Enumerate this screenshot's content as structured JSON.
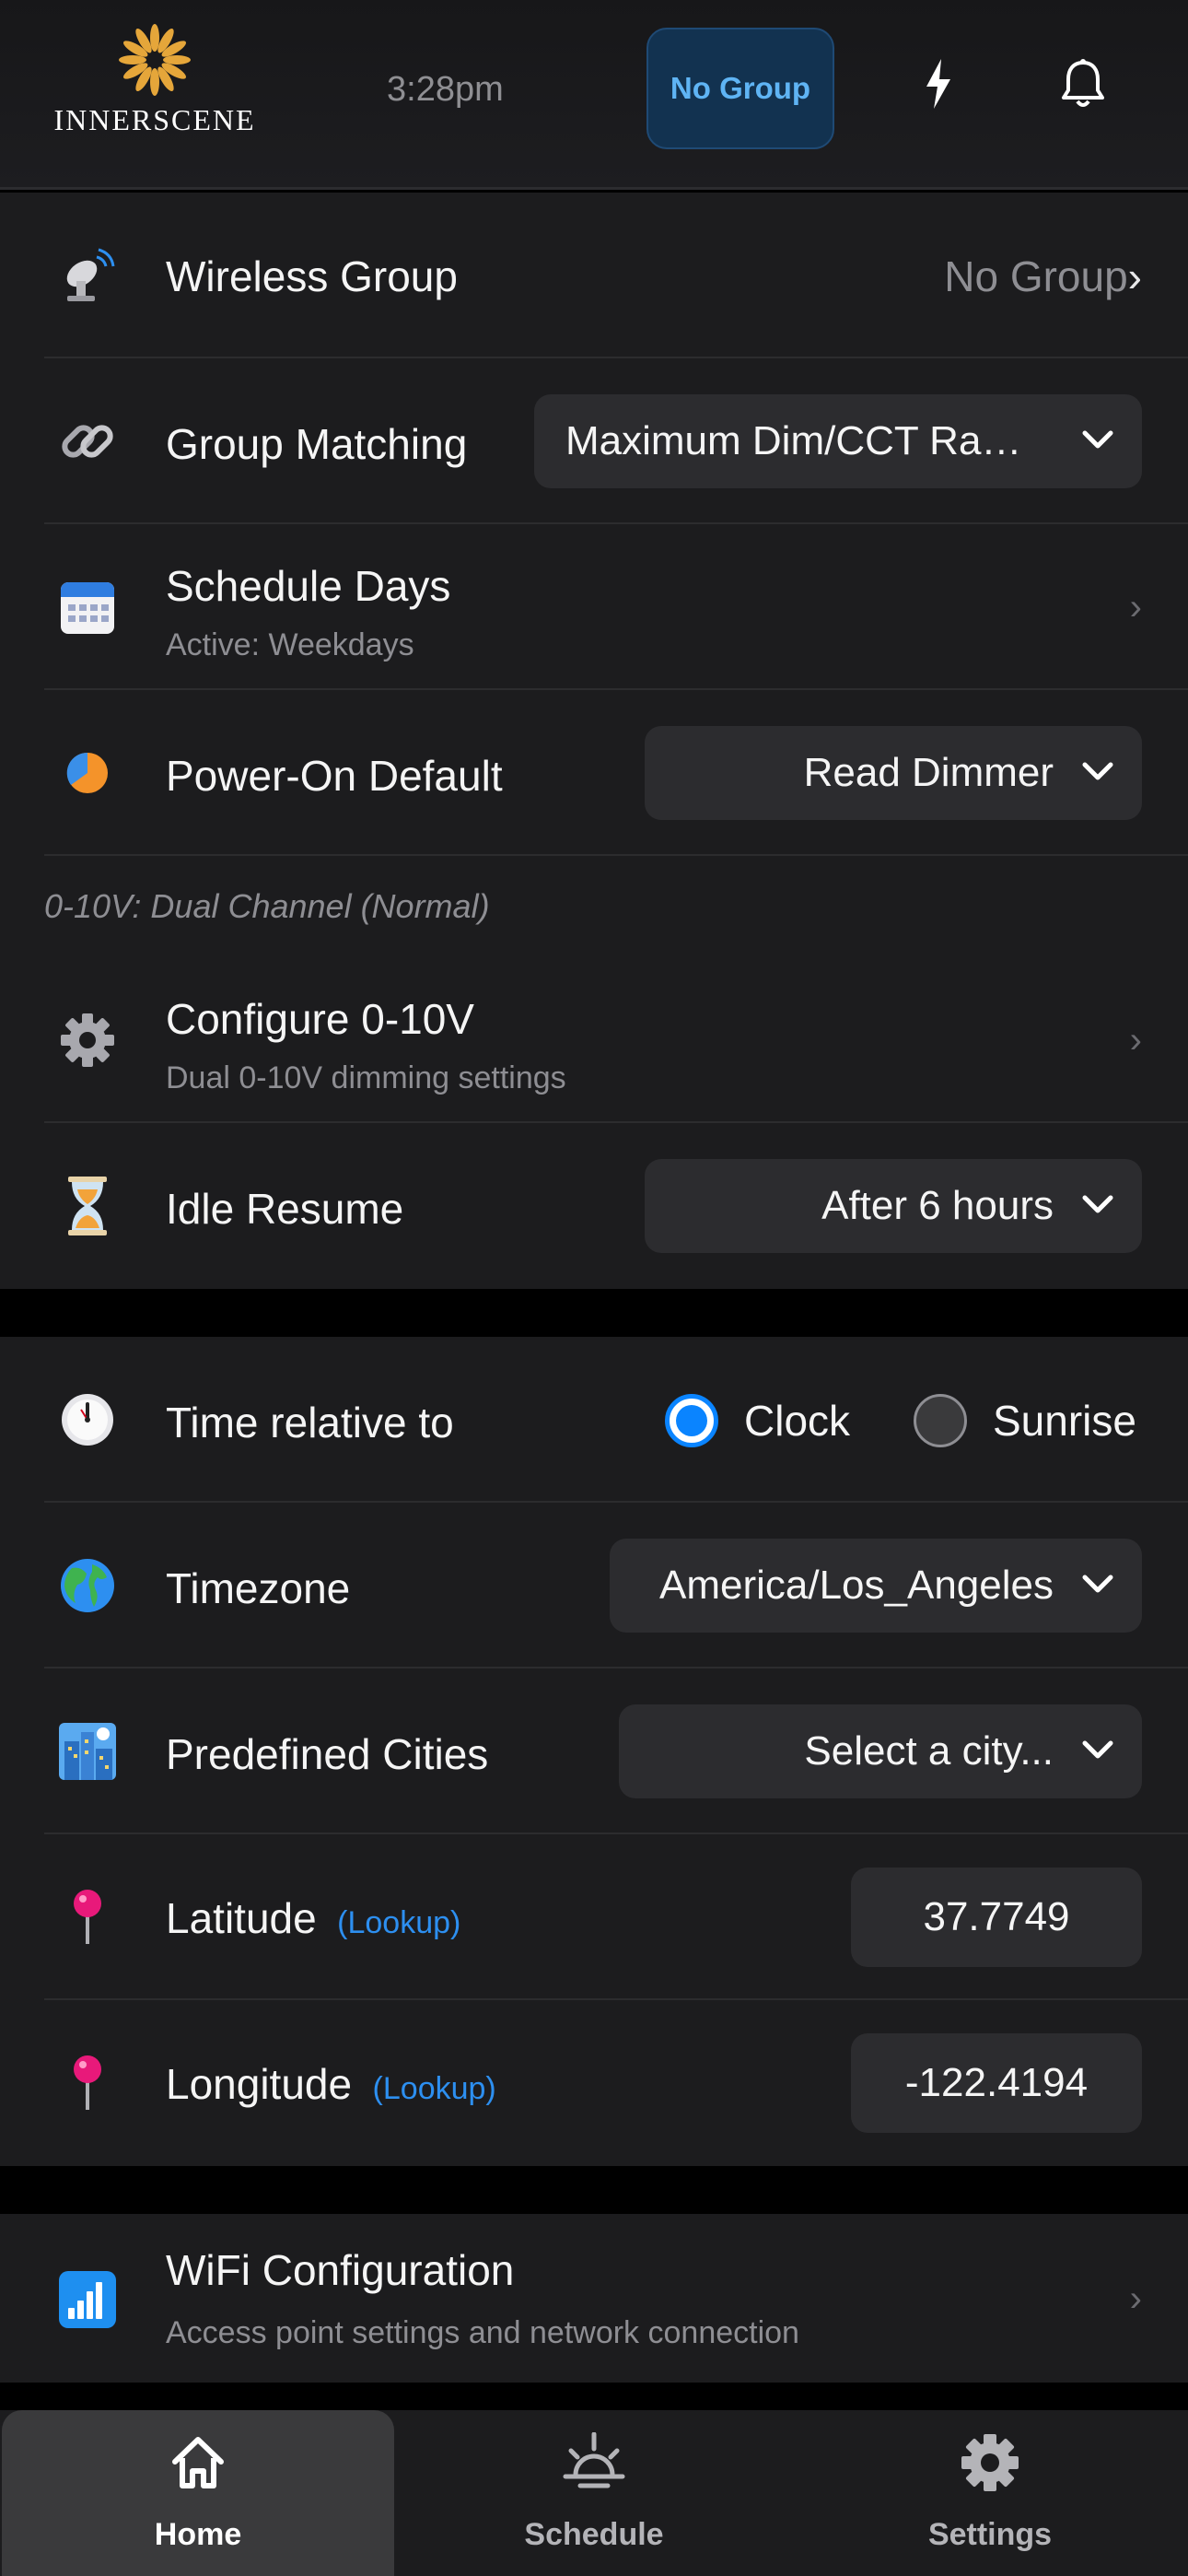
{
  "header": {
    "logo_text": "INNERSCENE",
    "time": "3:28pm",
    "group_button": "No Group",
    "accent": "#5fb4f4"
  },
  "section1": {
    "wireless_group": {
      "label": "Wireless Group",
      "value": "No Group",
      "chevron": "›",
      "icon": "satellite-dish-icon"
    },
    "group_matching": {
      "label": "Group Matching",
      "value": "Maximum Dim/CCT Ra…",
      "icon": "link-icon"
    },
    "schedule_days": {
      "label": "Schedule Days",
      "sub": "Active: Weekdays",
      "chevron": "›",
      "icon": "calendar-icon"
    },
    "power_on_default": {
      "label": "Power-On Default",
      "value": "Read Dimmer",
      "icon": "half-circle-icon"
    },
    "note": "0-10V: Dual Channel (Normal)",
    "configure": {
      "label": "Configure 0-10V",
      "sub": "Dual 0-10V dimming settings",
      "chevron": "›",
      "icon": "gear-icon"
    },
    "idle_resume": {
      "label": "Idle Resume",
      "value": "After 6 hours",
      "icon": "hourglass-icon"
    }
  },
  "section2": {
    "time_relative": {
      "label": "Time relative to",
      "options": [
        "Clock",
        "Sunrise"
      ],
      "selected": "Clock",
      "icon": "clock-icon"
    },
    "timezone": {
      "label": "Timezone",
      "value": "America/Los_Angeles",
      "icon": "globe-icon"
    },
    "cities": {
      "label": "Predefined Cities",
      "value": "Select a city...",
      "icon": "cityscape-icon"
    },
    "latitude": {
      "label": "Latitude",
      "lookup": "(Lookup)",
      "value": "37.7749",
      "icon": "pin-icon"
    },
    "longitude": {
      "label": "Longitude",
      "lookup": "(Lookup)",
      "value": "-122.4194",
      "icon": "pin-icon"
    }
  },
  "section3": {
    "wifi": {
      "label": "WiFi Configuration",
      "sub": "Access point settings and network connection",
      "chevron": "›",
      "icon": "signal-bars-icon"
    }
  },
  "nav": {
    "items": [
      {
        "label": "Home",
        "icon": "home-icon",
        "active": true
      },
      {
        "label": "Schedule",
        "icon": "sunrise-icon",
        "active": false
      },
      {
        "label": "Settings",
        "icon": "gear-icon",
        "active": false
      }
    ]
  }
}
